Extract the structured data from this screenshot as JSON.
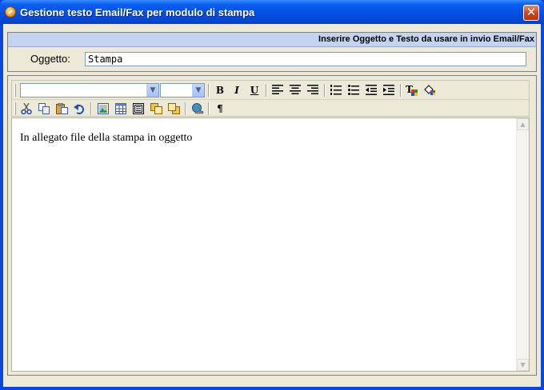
{
  "window": {
    "title": "Gestione testo Email/Fax per modulo di stampa",
    "close_label": "✕"
  },
  "subject_section": {
    "hint": "Inserire Oggetto e Testo da usare in  invio Email/Fax",
    "label": "Oggetto:",
    "value": "Stampa"
  },
  "toolbar": {
    "font_family": "",
    "font_size": "",
    "dropdown_arrow": "▼",
    "bold": "B",
    "italic": "I",
    "underline": "U",
    "paragraph_mark": "¶",
    "row1_icons": [
      "bold-icon",
      "italic-icon",
      "underline-icon",
      "align-left-icon",
      "align-center-icon",
      "align-right-icon",
      "numbered-list-icon",
      "bullet-list-icon",
      "outdent-icon",
      "indent-icon",
      "text-color-icon",
      "highlight-color-icon"
    ],
    "row2_icons": [
      "cut-icon",
      "copy-icon",
      "paste-icon",
      "undo-icon",
      "insert-image-icon",
      "insert-table-icon",
      "insert-frame-icon",
      "bring-forward-icon",
      "send-backward-icon",
      "insert-link-icon",
      "paragraph-mark-icon"
    ]
  },
  "editor": {
    "content": "In allegato file della stampa in oggetto",
    "scroll_up": "▲",
    "scroll_down": "▼"
  },
  "colors": {
    "titlebar": "#0551e6",
    "window_bg": "#ece9d8",
    "hint_bar": "#c3d4f0",
    "close_button": "#d2441f"
  }
}
